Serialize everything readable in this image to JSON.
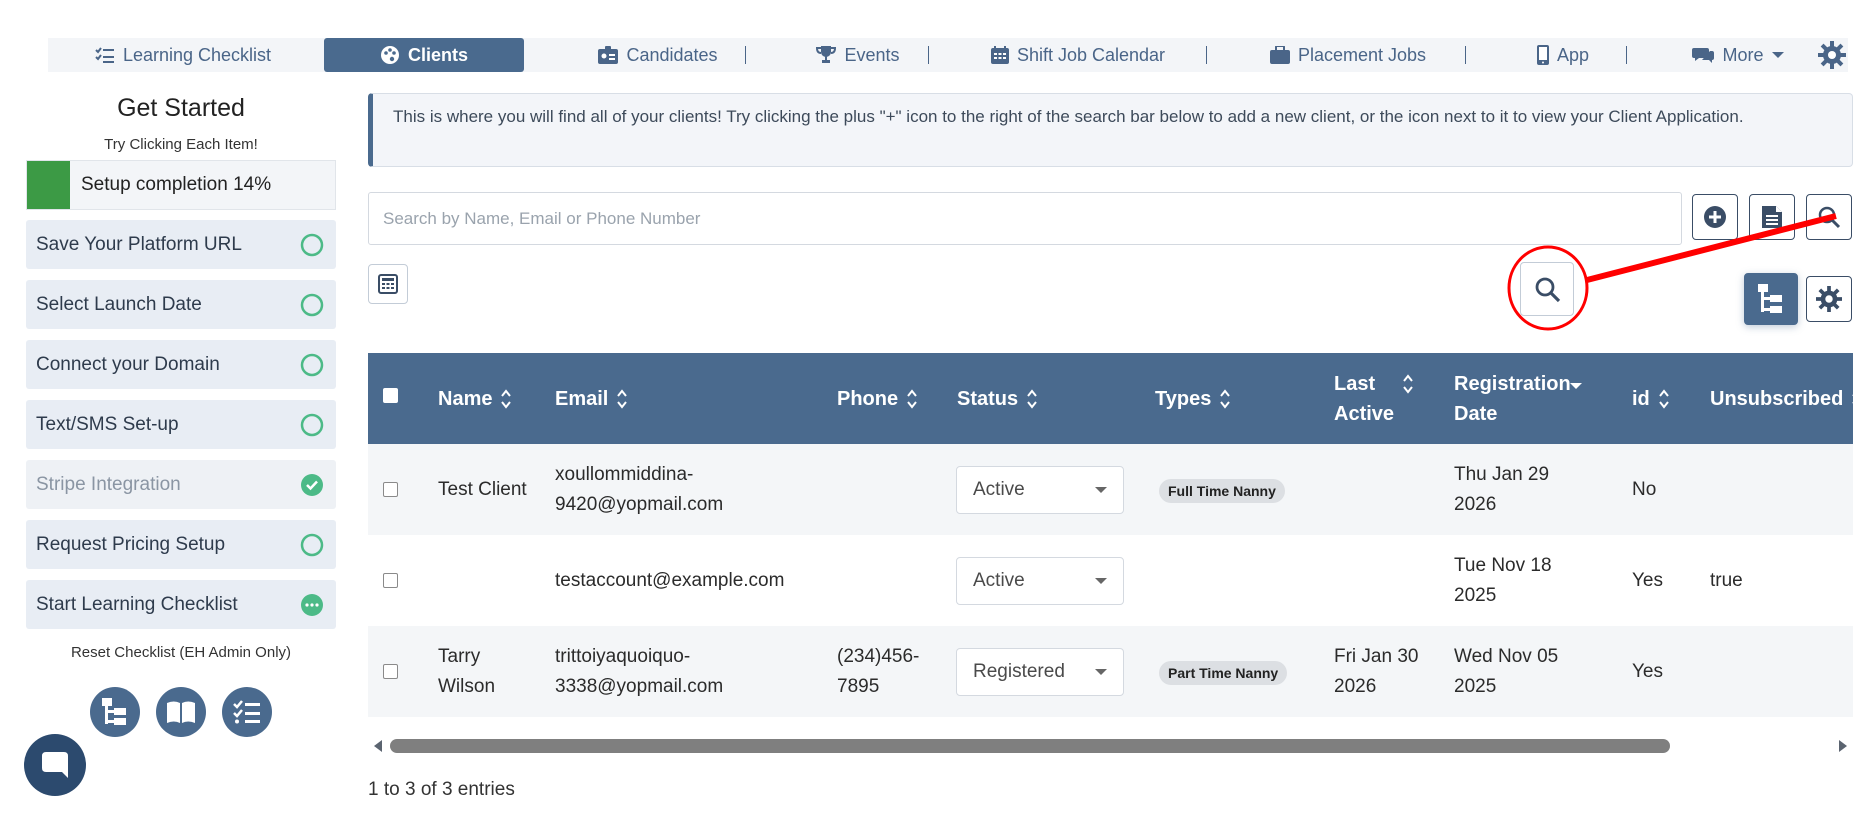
{
  "nav": {
    "tabs": [
      {
        "label": "Learning Checklist",
        "icon": "checklist-icon",
        "active": false
      },
      {
        "label": "Clients",
        "icon": "palette-icon",
        "active": true
      },
      {
        "label": "Candidates",
        "icon": "id-card-icon",
        "active": false
      },
      {
        "label": "Events",
        "icon": "trophy-icon",
        "active": false
      },
      {
        "label": "Shift Job Calendar",
        "icon": "calendar-icon",
        "active": false
      },
      {
        "label": "Placement Jobs",
        "icon": "briefcase-icon",
        "active": false
      },
      {
        "label": "App",
        "icon": "mobile-icon",
        "active": false
      },
      {
        "label": "More",
        "icon": "comments-icon",
        "active": false
      }
    ],
    "settings_icon": "gear-icon"
  },
  "sidebar": {
    "title": "Get Started",
    "subtitle": "Try Clicking Each Item!",
    "progress": {
      "label": "Setup completion 14%",
      "percent": 14
    },
    "items": [
      {
        "label": "Save Your Platform URL",
        "state": "todo"
      },
      {
        "label": "Select Launch Date",
        "state": "todo"
      },
      {
        "label": "Connect your Domain",
        "state": "todo"
      },
      {
        "label": "Text/SMS Set-up",
        "state": "todo"
      },
      {
        "label": "Stripe Integration",
        "state": "done"
      },
      {
        "label": "Request Pricing Setup",
        "state": "todo"
      },
      {
        "label": "Start Learning Checklist",
        "state": "in-progress"
      }
    ],
    "reset_label": "Reset Checklist (EH Admin Only)",
    "icons": [
      "sitemap-icon",
      "book-icon",
      "checklist-icon"
    ]
  },
  "main": {
    "info": "This is where you will find all of your clients! Try clicking the plus \"+\" icon to the right of the search bar below to add a new client, or the icon next to it to view your Client Application.",
    "search": {
      "placeholder": "Search by Name, Email or Phone Number",
      "value": ""
    },
    "table": {
      "columns": [
        "Name",
        "Email",
        "Phone",
        "Status",
        "Types",
        "Last Active",
        "Registration Date",
        "id",
        "Unsubscribed"
      ],
      "rows": [
        {
          "name": "Test Client",
          "email": "xoullommiddina-9420@yopmail.com",
          "phone": "",
          "status": "Active",
          "type": "Full Time Nanny",
          "last_active": "",
          "registration_date": "Thu Jan 29 2026",
          "id": "No",
          "unsubscribed": ""
        },
        {
          "name": "",
          "email": "testaccount@example.com",
          "phone": "",
          "status": "Active",
          "type": "",
          "last_active": "",
          "registration_date": "Tue Nov 18 2025",
          "id": "Yes",
          "unsubscribed": "true"
        },
        {
          "name": "Tarry Wilson",
          "email": "trittoiyaquoiquo-3338@yopmail.com",
          "phone": "(234)456-7895",
          "status": "Registered",
          "type": "Part Time Nanny",
          "last_active": "Fri Jan 30 2026",
          "registration_date": "Wed Nov 05 2025",
          "id": "Yes",
          "unsubscribed": ""
        }
      ]
    },
    "entries_label": "1 to 3 of 3 entries"
  },
  "colors": {
    "primary": "#4a6a8e",
    "progress": "#3c9a45",
    "annotation": "#ff0000",
    "check": "#4cba87"
  }
}
